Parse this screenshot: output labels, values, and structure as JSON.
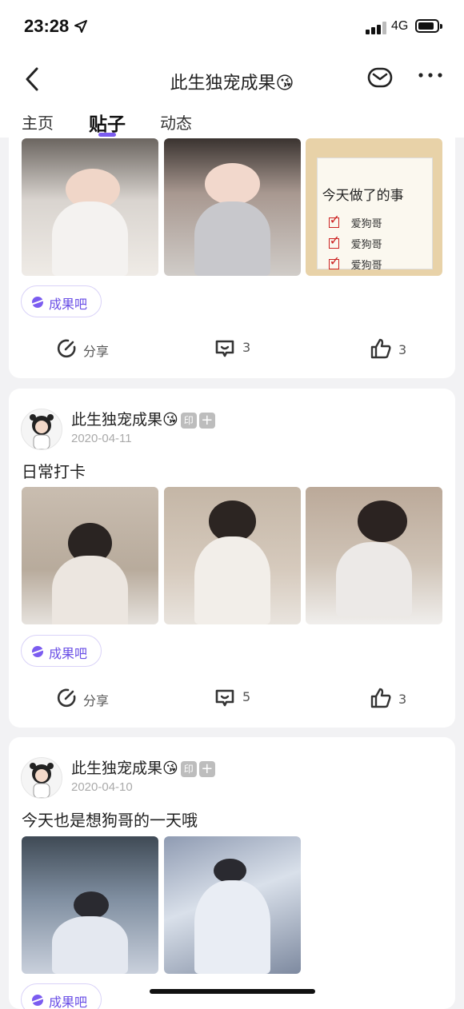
{
  "status_bar": {
    "time": "23:28",
    "network": "4G"
  },
  "nav": {
    "title": "此生独宠成果😘"
  },
  "tabs": [
    {
      "label": "主页",
      "active": false
    },
    {
      "label": "贴子",
      "active": true
    },
    {
      "label": "动态",
      "active": false
    }
  ],
  "note_card": {
    "title": "今天做了的事",
    "items": [
      "爱狗哥",
      "爱狗哥",
      "爱狗哥"
    ]
  },
  "posts": [
    {
      "tag": "成果吧",
      "share_label": "分享",
      "comments": "3",
      "likes": "3"
    },
    {
      "username": "此生独宠成果😘",
      "badge": "印",
      "date": "2020-04-11",
      "text": "日常打卡",
      "tag": "成果吧",
      "share_label": "分享",
      "comments": "5",
      "likes": "3"
    },
    {
      "username": "此生独宠成果😘",
      "badge": "印",
      "date": "2020-04-10",
      "text": "今天也是想狗哥的一天哦",
      "tag": "成果吧"
    }
  ],
  "colors": {
    "accent": "#7b5cf0",
    "tag_text": "#6a4fe6",
    "date": "#aaaaaa"
  }
}
